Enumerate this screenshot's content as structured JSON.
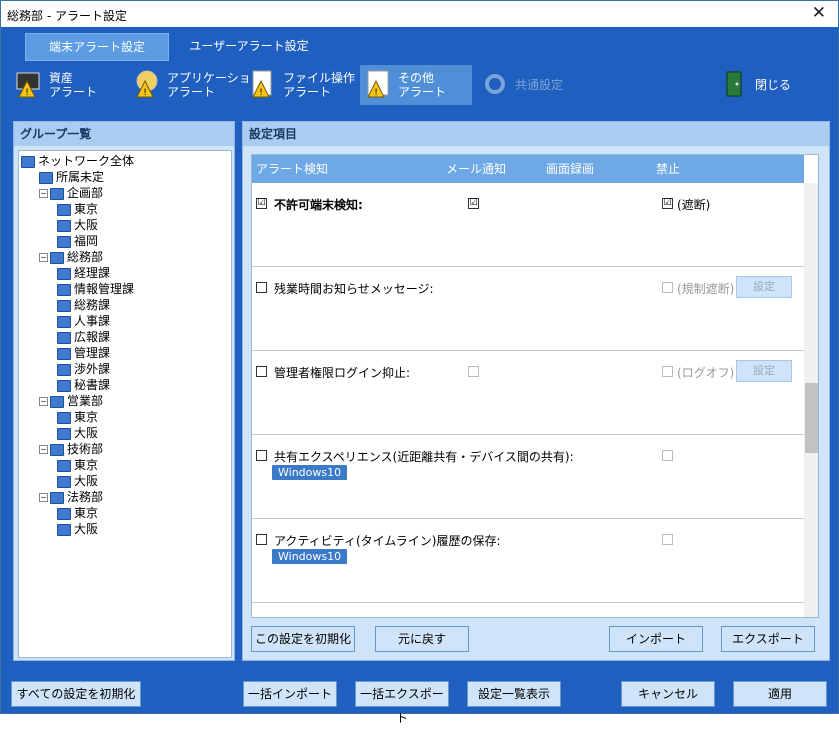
{
  "window": {
    "title": "総務部 - アラート設定",
    "close": "✕"
  },
  "tabs": [
    {
      "label": "端末アラート設定"
    },
    {
      "label": "ユーザーアラート設定"
    }
  ],
  "toolbar": {
    "asset": "資産\nアラート",
    "app": "アプリケーション\nアラート",
    "file": "ファイル操作\nアラート",
    "other": "その他\nアラート",
    "common": "共通設定",
    "close": "閉じる"
  },
  "group_panel": {
    "title": "グループ一覧"
  },
  "tree": [
    {
      "label": "ネットワーク全体"
    },
    {
      "label": "所属未定"
    },
    {
      "label": "企画部"
    },
    {
      "label": "東京"
    },
    {
      "label": "大阪"
    },
    {
      "label": "福岡"
    },
    {
      "label": "総務部"
    },
    {
      "label": "経理課"
    },
    {
      "label": "情報管理課"
    },
    {
      "label": "総務課"
    },
    {
      "label": "人事課"
    },
    {
      "label": "広報課"
    },
    {
      "label": "管理課"
    },
    {
      "label": "渉外課"
    },
    {
      "label": "秘書課"
    },
    {
      "label": "営業部"
    },
    {
      "label": "東京"
    },
    {
      "label": "大阪"
    },
    {
      "label": "技術部"
    },
    {
      "label": "東京"
    },
    {
      "label": "大阪"
    },
    {
      "label": "法務部"
    },
    {
      "label": "東京"
    },
    {
      "label": "大阪"
    }
  ],
  "settings_panel": {
    "title": "設定項目",
    "columns": {
      "detect": "アラート検知",
      "mail": "メール通知",
      "screen": "画面録画",
      "ban": "禁止"
    }
  },
  "rows": [
    {
      "label": "不許可端末検知:",
      "checked": "☑",
      "mail": "☑",
      "ban": "☑",
      "ban_label": "(遮断)"
    },
    {
      "label": "残業時間お知らせメッセージ:",
      "ban_label": "(規制遮断)",
      "setting": "設定"
    },
    {
      "label": "管理者権限ログイン抑止:",
      "ban_label": "(ログオフ)",
      "setting": "設定"
    },
    {
      "label": "共有エクスペリエンス(近距離共有・デバイス間の共有):",
      "badge": "Windows10"
    },
    {
      "label": "アクティビティ(タイムライン)履歴の保存:",
      "badge": "Windows10"
    }
  ],
  "panel_buttons": {
    "reset": "この設定を初期化",
    "revert": "元に戻す",
    "import": "インポート",
    "export": "エクスポート"
  },
  "footer": {
    "reset_all": "すべての設定を初期化",
    "bulk_import": "一括インポート",
    "bulk_export": "一括エクスポート",
    "list": "設定一覧表示",
    "cancel": "キャンセル",
    "apply": "適用"
  },
  "colors": {
    "accent": "#1f5fbf",
    "panel": "#cfe4f8",
    "header": "#6ea9e6"
  }
}
